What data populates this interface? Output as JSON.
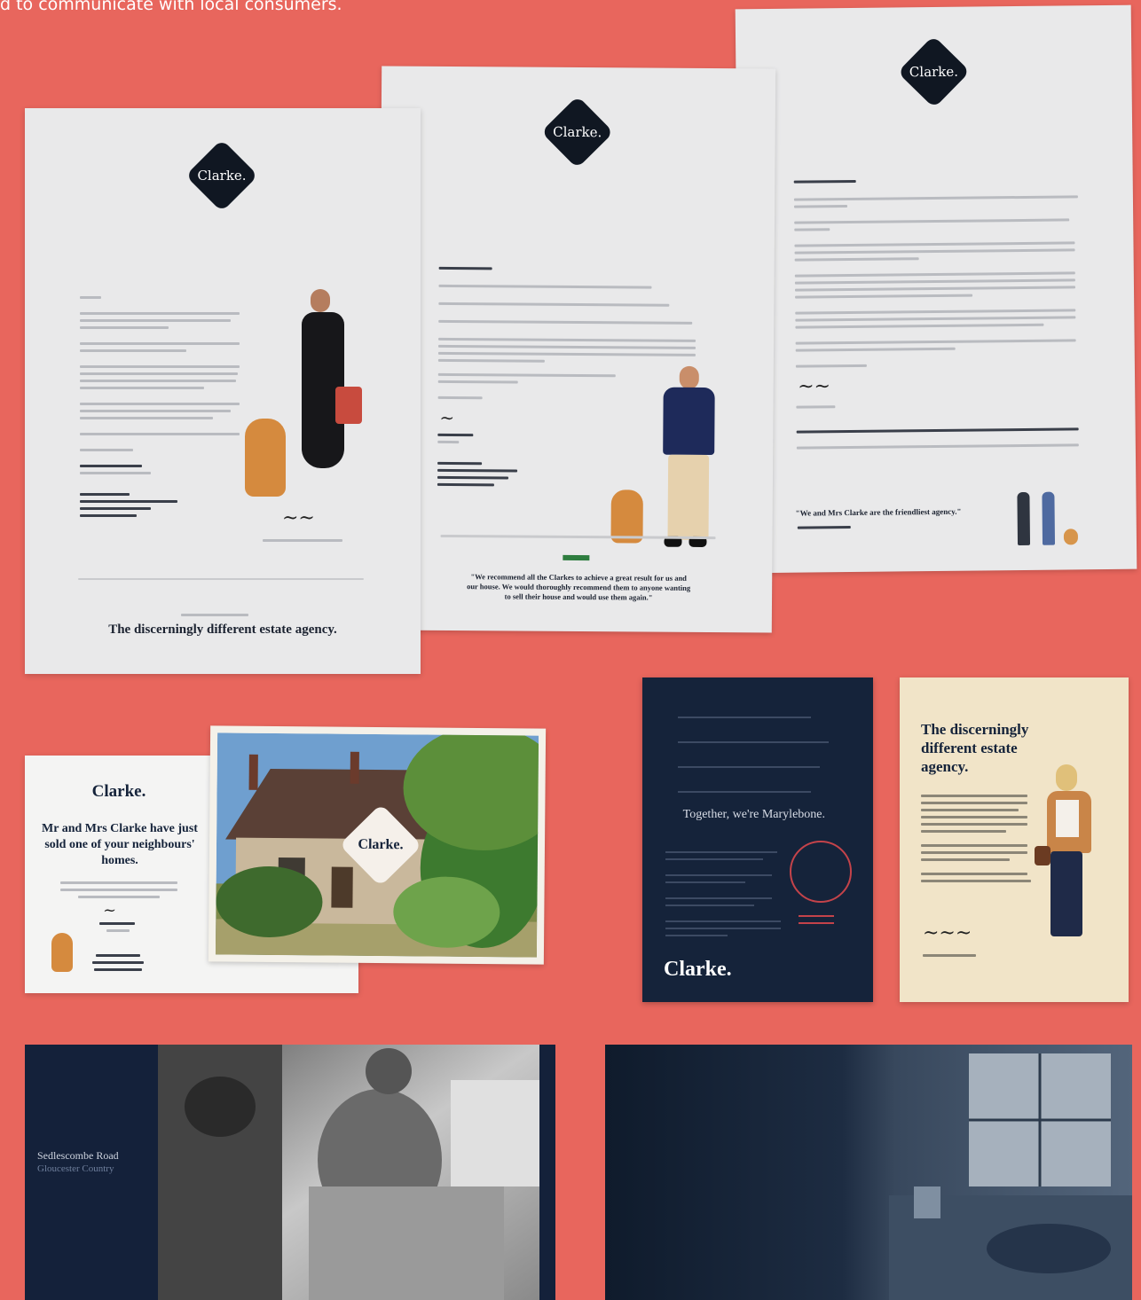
{
  "caption": "d to communicate with local consumers.",
  "brand": {
    "logo": "Clarke.",
    "colors": {
      "background": "#e8665d",
      "navy": "#15233a",
      "diamond": "#101722",
      "cream": "#f1e4c8"
    }
  },
  "letter1": {
    "tagline": "The discerningly different estate agency."
  },
  "letter2": {
    "quote": "\"We recommend all the Clarkes to achieve a great result for us and our house. We would thoroughly recommend them to anyone wanting to sell their house and would use them again.\""
  },
  "letter3": {
    "quote": "\"We and Mrs Clarke are the friendliest agency.\""
  },
  "postcard": {
    "logo": "Clarke.",
    "headline": "Mr and Mrs Clarke have just sold one of your neighbours' homes.",
    "photo_logo": "Clarke."
  },
  "dark_ad": {
    "headline": "Together, we're Marylebone.",
    "logo": "Clarke."
  },
  "cream_ad": {
    "headline": "The discerningly different estate agency."
  },
  "brochure": {
    "title_line1": "Sedlescombe Road",
    "title_line2": "Gloucester Country"
  },
  "icons": [
    "diamond-logo-icon",
    "dog-icon",
    "person-icon",
    "signature-icon"
  ]
}
